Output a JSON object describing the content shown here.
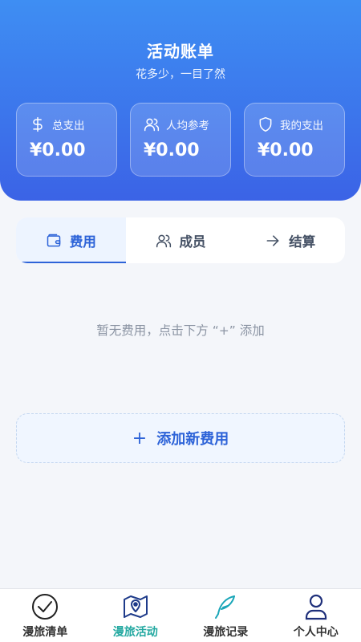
{
  "header": {
    "title": "活动账单",
    "subtitle": "花多少，一目了然"
  },
  "cards": [
    {
      "label": "总支出",
      "amount": "¥0.00",
      "icon": "dollar-icon"
    },
    {
      "label": "人均参考",
      "amount": "¥0.00",
      "icon": "users-icon"
    },
    {
      "label": "我的支出",
      "amount": "¥0.00",
      "icon": "shield-icon"
    }
  ],
  "tabs": [
    {
      "label": "费用",
      "icon": "wallet-icon",
      "active": true
    },
    {
      "label": "成员",
      "icon": "users-icon",
      "active": false
    },
    {
      "label": "结算",
      "icon": "arrow-right-icon",
      "active": false
    }
  ],
  "empty_text": "暂无费用，点击下方 “+” 添加",
  "add_button": {
    "plus": "+",
    "label": "添加新费用"
  },
  "bottom_nav": [
    {
      "label": "漫旅清单",
      "icon": "check-circle-icon",
      "active": false
    },
    {
      "label": "漫旅活动",
      "icon": "map-pin-icon",
      "active": true
    },
    {
      "label": "漫旅记录",
      "icon": "feather-icon",
      "active": false
    },
    {
      "label": "个人中心",
      "icon": "user-icon",
      "active": false
    }
  ],
  "colors": {
    "header_top": "#3e8ef3",
    "header_bottom": "#3b63e6",
    "accent": "#2d63d8",
    "nav_active": "#22a8a0"
  }
}
